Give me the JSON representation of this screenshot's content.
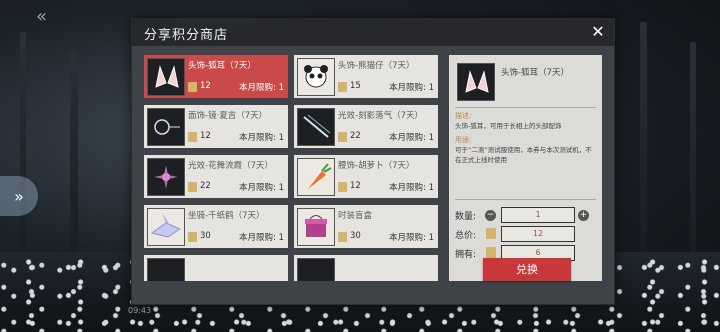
{
  "shop": {
    "title": "分享积分商店",
    "close_icon": "✕",
    "items": [
      {
        "name": "头饰-狐耳（7天）",
        "price": "12",
        "limit": "本月限购: 1",
        "icon": "fox-ears-icon",
        "selected": true
      },
      {
        "name": "头饰-熊猫仔（7天）",
        "price": "15",
        "limit": "本月限购: 1",
        "icon": "panda-icon",
        "selected": false
      },
      {
        "name": "面饰-镜·夏吉（7天）",
        "price": "12",
        "limit": "本月限购: 1",
        "icon": "monocle-icon",
        "selected": false
      },
      {
        "name": "光效-刻影落气（7天）",
        "price": "22",
        "limit": "本月限购: 1",
        "icon": "sword-light-icon",
        "selected": false
      },
      {
        "name": "光效-花舞流霞（7天）",
        "price": "22",
        "limit": "本月限购: 1",
        "icon": "flower-light-icon",
        "selected": false
      },
      {
        "name": "腰饰-胡萝卜（7天）",
        "price": "12",
        "limit": "本月限购: 1",
        "icon": "carrot-icon",
        "selected": false
      },
      {
        "name": "坐骑-千纸鹤（7天）",
        "price": "30",
        "limit": "本月限购: 1",
        "icon": "paper-crane-icon",
        "selected": false
      },
      {
        "name": "时装盲盒",
        "price": "30",
        "limit": "本月限购: 1",
        "icon": "blind-box-icon",
        "selected": false
      }
    ],
    "detail": {
      "name": "头饰-狐耳（7天）",
      "desc_label": "描述:",
      "desc_text": "头饰-狐耳，可用于长相上的头部配饰",
      "use_label": "用途:",
      "use_text": "可于“二测”测试服使用，本券与本次测试机，不在正式上线时使用",
      "qty_label": "数量:",
      "qty_value": "1",
      "total_label": "总价:",
      "total_value": "12",
      "own_label": "拥有:",
      "own_value": "6",
      "minus_icon": "−",
      "plus_icon": "+",
      "exchange_label": "兑换"
    }
  },
  "hud": {
    "back_icon": "«",
    "left_tab_icon": "»",
    "bottom_text": "09:43"
  }
}
